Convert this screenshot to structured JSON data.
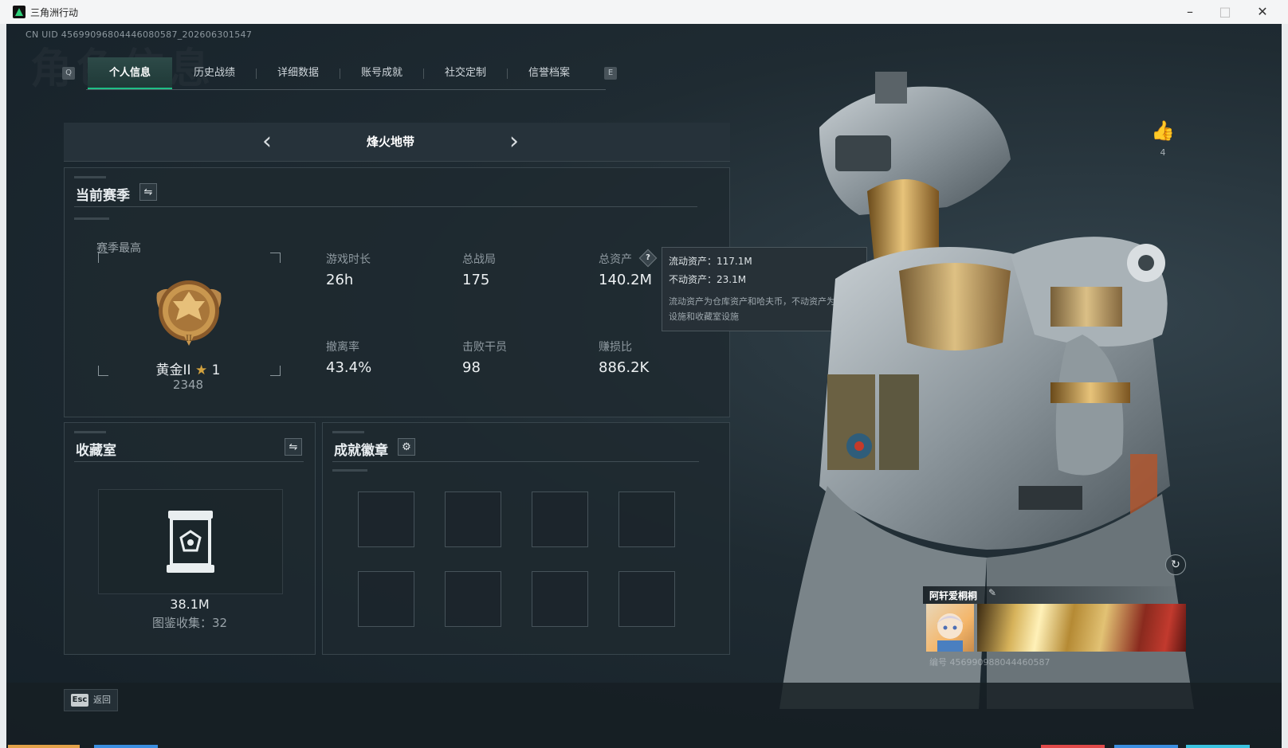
{
  "window": {
    "title": "三角洲行动",
    "minimize": "–",
    "maximize": "□",
    "close": "✕"
  },
  "uid": "CN UID 456990968044460805​87_202606301547",
  "bg_word": "角色信息",
  "tabs": {
    "prev_key": "Q",
    "next_key": "E",
    "items": [
      "个人信息",
      "历史战绩",
      "详细数据",
      "账号成就",
      "社交定制",
      "信誉档案"
    ],
    "active": 0
  },
  "mode": {
    "prev": "‹",
    "label": "烽火地带",
    "next": "›"
  },
  "season": {
    "title": "当前赛季",
    "switch_icon": "⇋",
    "best_label": "赛季最高",
    "rank": "黄金II",
    "rank_star": "★",
    "rank_level": "1",
    "score": "2348",
    "stats": [
      {
        "label": "游戏时长",
        "value": "26h"
      },
      {
        "label": "总战局",
        "value": "175"
      },
      {
        "label": "总资产",
        "value": "140.2M"
      },
      {
        "label": "撤离率",
        "value": "43.4%"
      },
      {
        "label": "击败干员",
        "value": "98"
      },
      {
        "label": "赚损比",
        "value": "886.2K"
      }
    ],
    "help_icon": "?"
  },
  "tooltip": {
    "liquid": "流动资产：117.1M",
    "fixed": "不动资产：23.1M",
    "note": "流动资产为仓库资产和哈夫币，不动资产为特勤处设施和收藏室设施"
  },
  "collection": {
    "title": "收藏室",
    "switch_icon": "⇋",
    "value": "38.1M",
    "count": "图鉴收集：32"
  },
  "badges": {
    "title": "成就徽章",
    "gear_icon": "⚙",
    "slots": 8
  },
  "profile": {
    "like_icon": "👍",
    "like_count": "4",
    "refresh_icon": "↻",
    "nickname": "阿轩爱桐桐",
    "edit_icon": "✎",
    "player_id": "编号 456990988044460587"
  },
  "footer": {
    "esc_key": "Esc",
    "back_label": "返回"
  }
}
